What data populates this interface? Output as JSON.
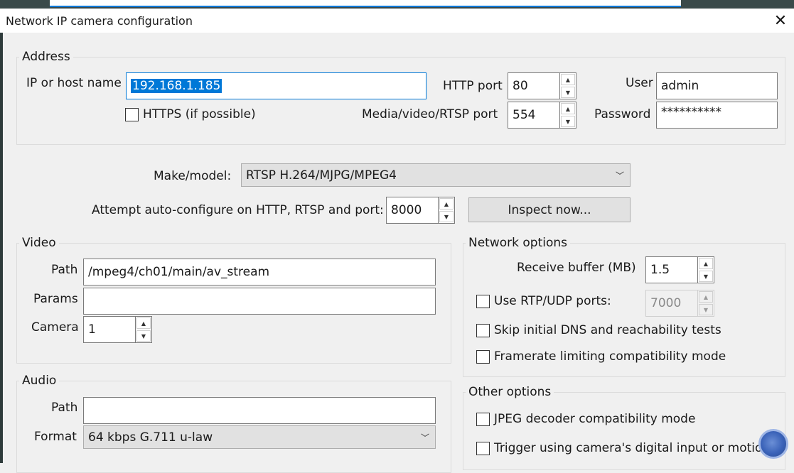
{
  "window": {
    "title": "Network IP camera configuration",
    "close_glyph": "✕"
  },
  "address": {
    "legend": "Address",
    "ip_label": "IP or host name",
    "ip_value": "192.168.1.185",
    "https_label": "HTTPS (if possible)",
    "http_port_label": "HTTP port",
    "http_port_value": "80",
    "media_port_label": "Media/video/RTSP port",
    "media_port_value": "554",
    "user_label": "User",
    "user_value": "admin",
    "password_label": "Password",
    "password_value": "**********"
  },
  "make_model": {
    "label": "Make/model:",
    "value": "RTSP H.264/MJPG/MPEG4"
  },
  "autoconfig": {
    "label": "Attempt auto-configure on HTTP, RTSP and port:",
    "port_value": "8000",
    "inspect_label": "Inspect now..."
  },
  "video": {
    "legend": "Video",
    "path_label": "Path",
    "path_value": "/mpeg4/ch01/main/av_stream",
    "params_label": "Params",
    "params_value": "",
    "camera_label": "Camera",
    "camera_value": "1"
  },
  "network": {
    "legend": "Network options",
    "buffer_label": "Receive buffer (MB)",
    "buffer_value": "1.5",
    "rtp_label": "Use RTP/UDP ports:",
    "rtp_value": "7000",
    "skip_dns_label": "Skip initial DNS and reachability tests",
    "framerate_label": "Framerate limiting compatibility mode"
  },
  "audio": {
    "legend": "Audio",
    "path_label": "Path",
    "path_value": "",
    "format_label": "Format",
    "format_value": "64 kbps G.711 u-law"
  },
  "other": {
    "legend": "Other options",
    "jpeg_label": "JPEG decoder compatibility mode",
    "trigger_label": "Trigger using camera's digital input or motion"
  }
}
